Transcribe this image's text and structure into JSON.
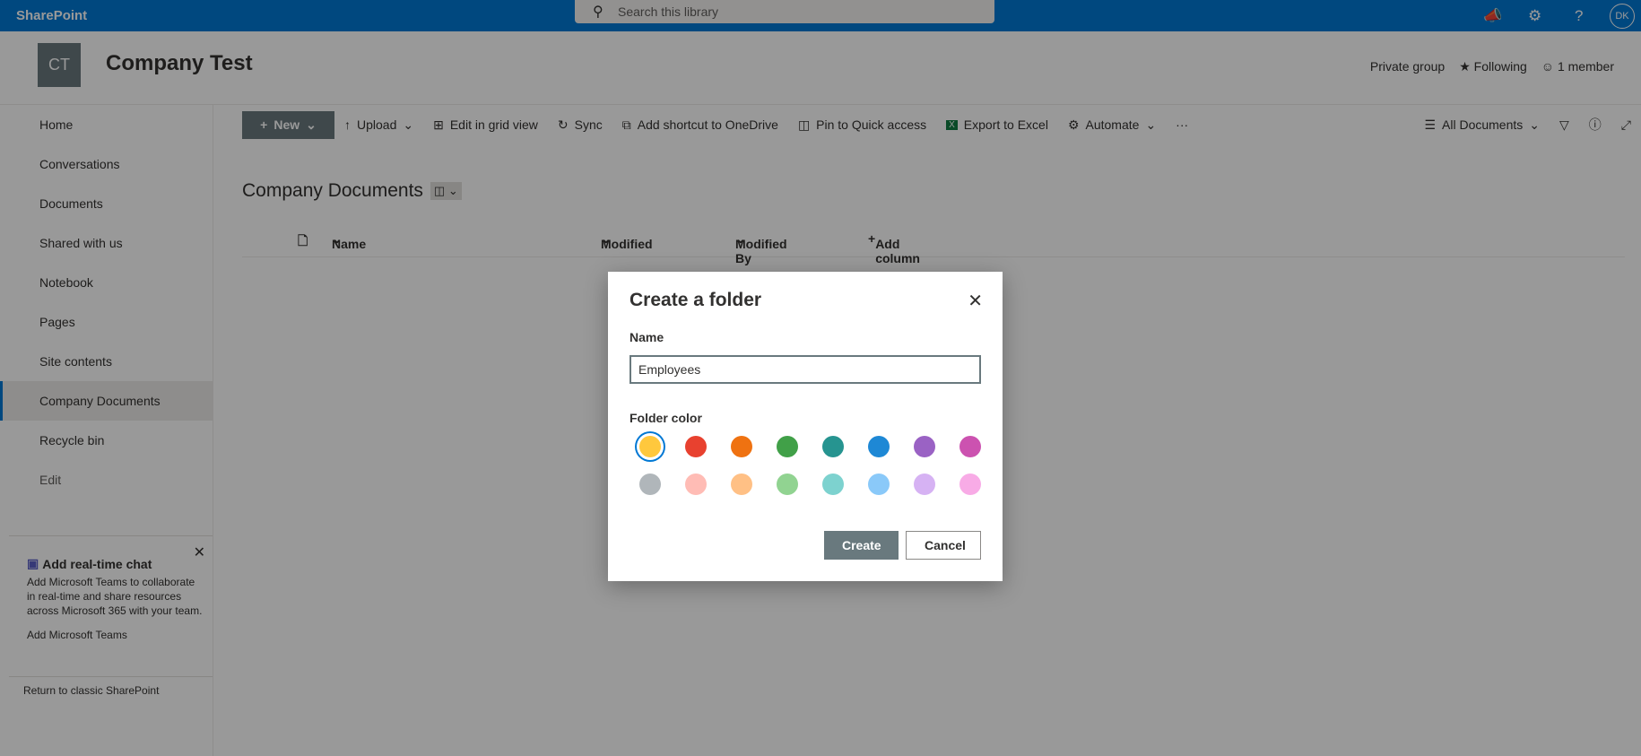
{
  "topbar": {
    "brand": "SharePoint",
    "search_placeholder": "Search this library",
    "avatar": "DK"
  },
  "site": {
    "logo": "CT",
    "title": "Company Test",
    "privacy": "Private group",
    "following": "Following",
    "members": "1 member"
  },
  "nav": {
    "items": [
      {
        "label": "Home"
      },
      {
        "label": "Conversations"
      },
      {
        "label": "Documents"
      },
      {
        "label": "Shared with us"
      },
      {
        "label": "Notebook"
      },
      {
        "label": "Pages"
      },
      {
        "label": "Site contents"
      },
      {
        "label": "Company Documents",
        "selected": true
      },
      {
        "label": "Recycle bin"
      }
    ],
    "edit": "Edit"
  },
  "promo": {
    "title": "Add real-time chat",
    "body": "Add Microsoft Teams to collaborate in real-time and share resources across Microsoft 365 with your team.",
    "link": "Add Microsoft Teams"
  },
  "classic": "Return to classic SharePoint",
  "commands": {
    "new": "New",
    "upload": "Upload",
    "grid": "Edit in grid view",
    "sync": "Sync",
    "shortcut": "Add shortcut to OneDrive",
    "pin": "Pin to Quick access",
    "export": "Export to Excel",
    "automate": "Automate",
    "more": "···",
    "view": "All Documents"
  },
  "library": {
    "title": "Company Documents",
    "columns": {
      "name": "Name",
      "modified": "Modified",
      "modified_by": "Modified By",
      "add": "Add column"
    }
  },
  "dialog": {
    "title": "Create a folder",
    "name_label": "Name",
    "name_value": "Employees",
    "color_label": "Folder color",
    "create": "Create",
    "cancel": "Cancel",
    "colors": [
      "#ffc83d",
      "#e8412f",
      "#ef7211",
      "#41a048",
      "#269490",
      "#1e88d5",
      "#9a62c4",
      "#cc52b0",
      "#b0b6ba",
      "#ffbcb5",
      "#ffc085",
      "#91d391",
      "#7dd2cf",
      "#8ac9f9",
      "#d6b2f3",
      "#f8abe6"
    ],
    "selected_color": "#ffc83d"
  }
}
